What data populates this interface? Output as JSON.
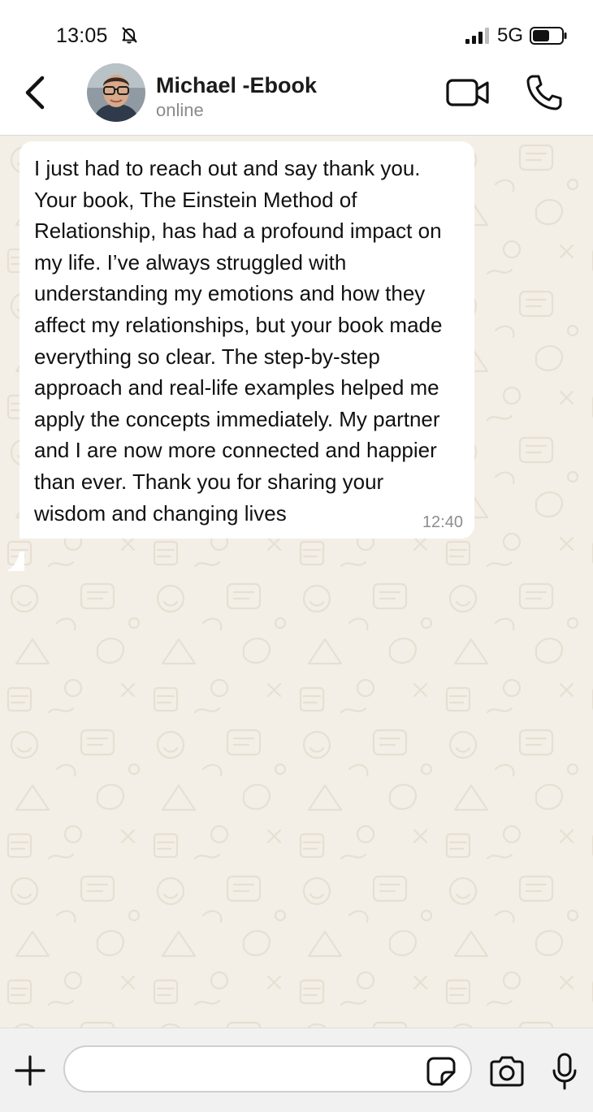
{
  "status_bar": {
    "time": "13:05",
    "network": "5G",
    "icons": [
      "bell-slash-icon",
      "signal-icon",
      "battery-icon"
    ]
  },
  "header": {
    "contact_name": "Michael -Ebook",
    "contact_status": "online",
    "icons": [
      "chevron-left-icon",
      "video-camera-icon",
      "phone-icon"
    ]
  },
  "messages": [
    {
      "direction": "incoming",
      "text": "I just had to reach out and say thank you. Your book, The Einstein Method of Relationship, has had a profound impact on my life. I’ve always struggled with understanding my emotions and how they affect my relationships, but your book made everything so clear. The step-by-step approach and real-life examples helped me apply the concepts immediately. My partner and I are now more connected and happier than ever. Thank you for sharing your wisdom and changing lives",
      "time": "12:40"
    }
  ],
  "input_bar": {
    "value": "",
    "placeholder": "",
    "icons": [
      "plus-icon",
      "sticker-icon",
      "camera-icon",
      "microphone-icon"
    ]
  },
  "colors": {
    "chat_background": "#f3efe6",
    "wallpaper_doodle": "#e6dfd2",
    "bubble": "#ffffff",
    "header": "#ffffff",
    "input_bar": "#f1f1f1",
    "timestamp": "#8d8d8d",
    "status_text": "#8a8a8a"
  }
}
